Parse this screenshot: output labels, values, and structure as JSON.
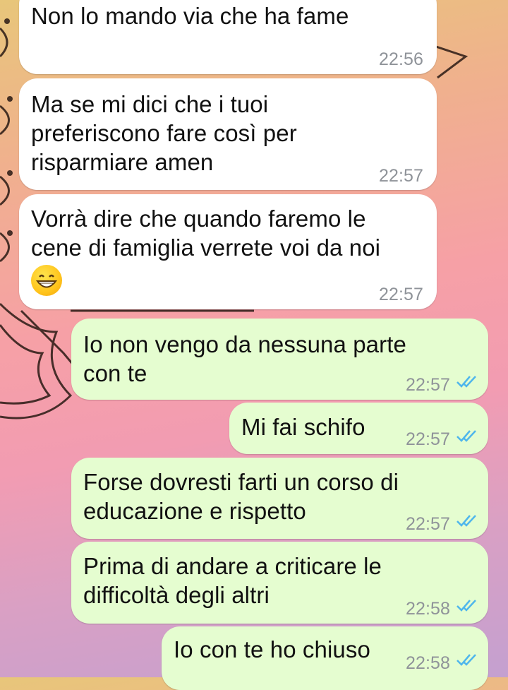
{
  "chat": {
    "messages": [
      {
        "direction": "incoming",
        "text": "Non lo mando via che ha fame",
        "time": "22:56"
      },
      {
        "direction": "incoming",
        "text": "Ma se mi dici che i tuoi\npreferiscono fare così per\nrisparmiare amen",
        "time": "22:57"
      },
      {
        "direction": "incoming",
        "text": "Vorrà dire che quando faremo le\ncene di famiglia verrete voi da noi",
        "emoji": "grinning-face-with-smiling-eyes",
        "time": "22:57"
      },
      {
        "direction": "outgoing",
        "text": "Io non vengo da nessuna parte\ncon te",
        "time": "22:57",
        "status": "read"
      },
      {
        "direction": "outgoing",
        "text": "Mi fai schifo",
        "time": "22:57",
        "status": "read"
      },
      {
        "direction": "outgoing",
        "text": "Forse dovresti farti un corso di\neducazione e rispetto",
        "time": "22:57",
        "status": "read"
      },
      {
        "direction": "outgoing",
        "text": "Prima di andare a criticare le\ndifficoltà degli altri",
        "time": "22:58",
        "status": "read"
      },
      {
        "direction": "outgoing",
        "text": "Io con te ho chiuso",
        "time": "22:58",
        "status": "read"
      }
    ]
  },
  "colors": {
    "incoming_bubble": "#ffffff",
    "outgoing_bubble": "#e5fdd0",
    "read_ticks": "#4fb6ec",
    "timestamp": "#8f9399"
  }
}
